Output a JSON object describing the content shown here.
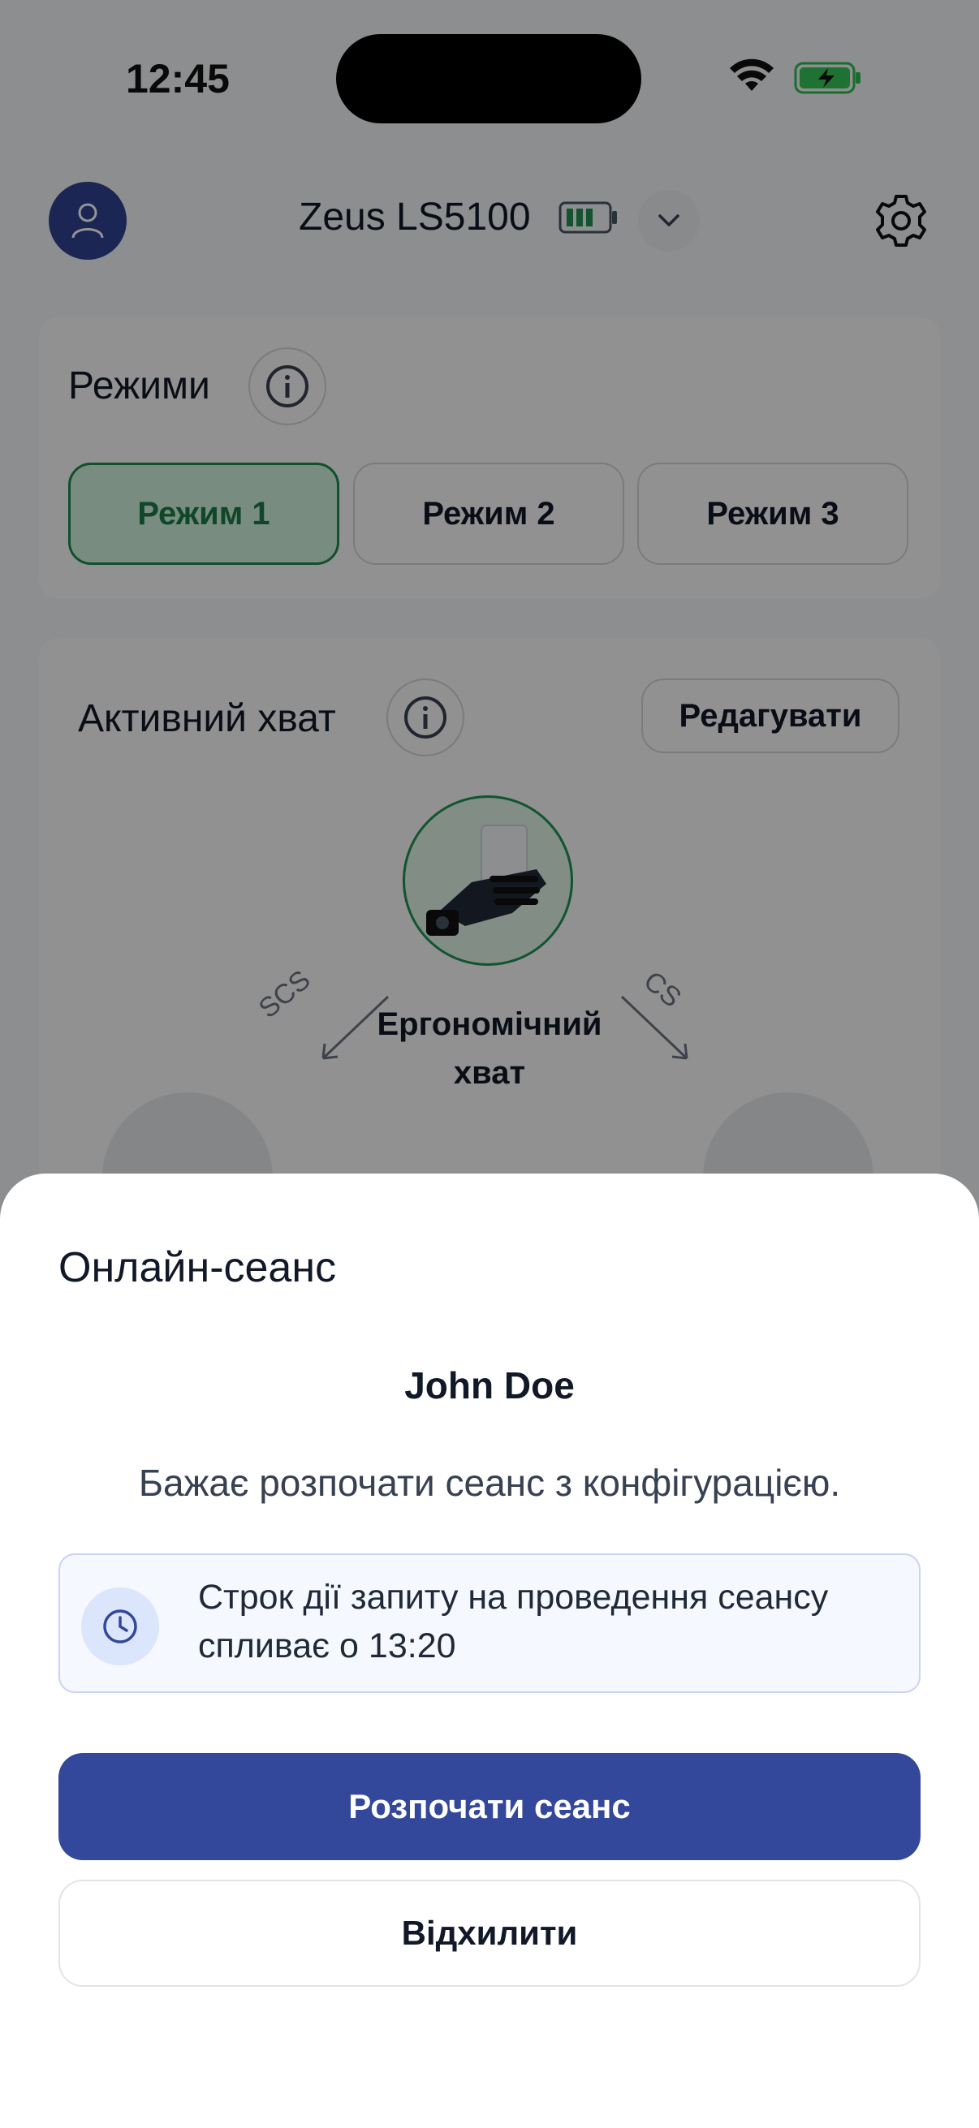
{
  "status_bar": {
    "time": "12:45"
  },
  "header": {
    "device_name": "Zeus LS5100"
  },
  "modes_card": {
    "title": "Режими",
    "modes": [
      {
        "label": "Режим 1",
        "active": true
      },
      {
        "label": "Режим 2",
        "active": false
      },
      {
        "label": "Режим 3",
        "active": false
      }
    ]
  },
  "grip_card": {
    "title": "Активний хват",
    "edit_label": "Редагувати",
    "active_grip_label": "Ергономічний хват",
    "left_tag": "SCS",
    "right_tag": "CS"
  },
  "sheet": {
    "title": "Онлайн-сеанс",
    "requester_name": "John Doe",
    "message": "Бажає розпочати сеанс з конфігурацією.",
    "notice_text": "Строк дії запиту на проведення сеансу спливає о 13:20",
    "primary_button": "Розпочати сеанс",
    "secondary_button": "Відхилити"
  },
  "colors": {
    "primary": "#33479b",
    "active_mode": "#1c8a4e",
    "avatar": "#2f4291"
  }
}
